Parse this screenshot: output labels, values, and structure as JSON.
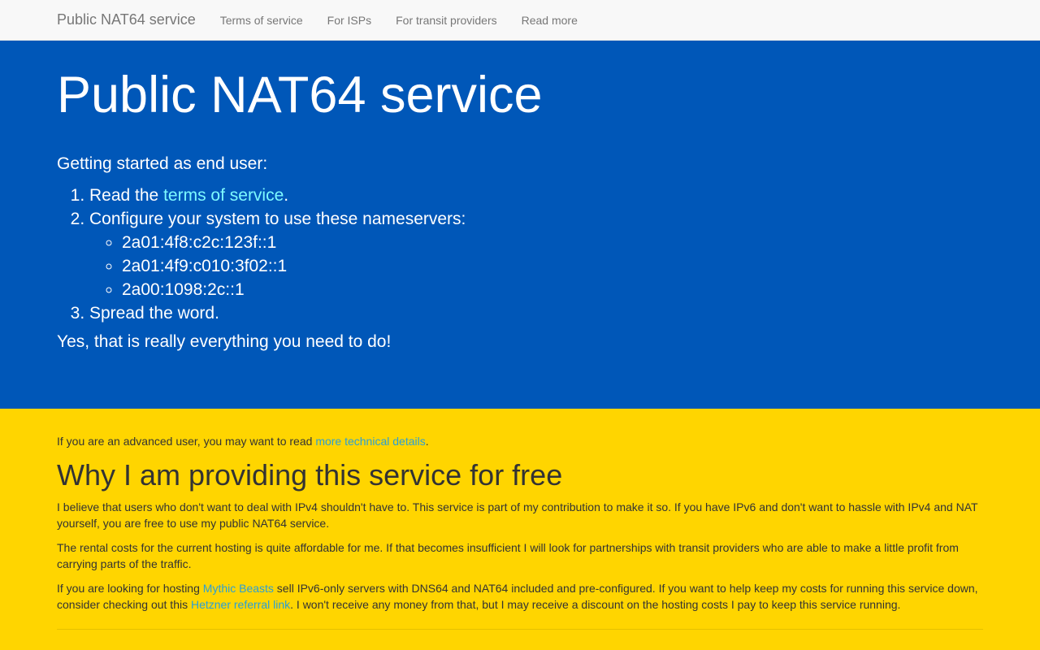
{
  "nav": {
    "brand": "Public NAT64 service",
    "links": [
      "Terms of service",
      "For ISPs",
      "For transit providers",
      "Read more"
    ]
  },
  "hero": {
    "title": "Public NAT64 service",
    "intro": "Getting started as end user:",
    "step1_prefix": "Read the ",
    "step1_link": "terms of service",
    "step1_suffix": ".",
    "step2": "Configure your system to use these nameservers:",
    "nameservers": [
      "2a01:4f8:c2c:123f::1",
      "2a01:4f9:c010:3f02::1",
      "2a00:1098:2c::1"
    ],
    "step3": "Spread the word.",
    "closing": "Yes, that is really everything you need to do!"
  },
  "content": {
    "advanced_prefix": "If you are an advanced user, you may want to read ",
    "advanced_link": "more technical details",
    "advanced_suffix": ".",
    "heading": "Why I am providing this service for free",
    "para1": "I believe that users who don't want to deal with IPv4 shouldn't have to. This service is part of my contribution to make it so. If you have IPv6 and don't want to hassle with IPv4 and NAT yourself, you are free to use my public NAT64 service.",
    "para2": "The rental costs for the current hosting is quite affordable for me. If that becomes insufficient I will look for partnerships with transit providers who are able to make a little profit from carrying parts of the traffic.",
    "para3_a": "If you are looking for hosting ",
    "para3_link1": "Mythic Beasts",
    "para3_b": " sell IPv6-only servers with DNS64 and NAT64 included and pre-configured. If you want to help keep my costs for running this service down, consider checking out this ",
    "para3_link2": "Hetzner referral link",
    "para3_c": ". I won't receive any money from that, but I may receive a discount on the hosting costs I pay to keep this service running."
  },
  "colors": {
    "hero_bg": "#0057b8",
    "page_bg": "#ffd500",
    "link": "#2a9fd6",
    "hero_link": "#7df9ff"
  }
}
